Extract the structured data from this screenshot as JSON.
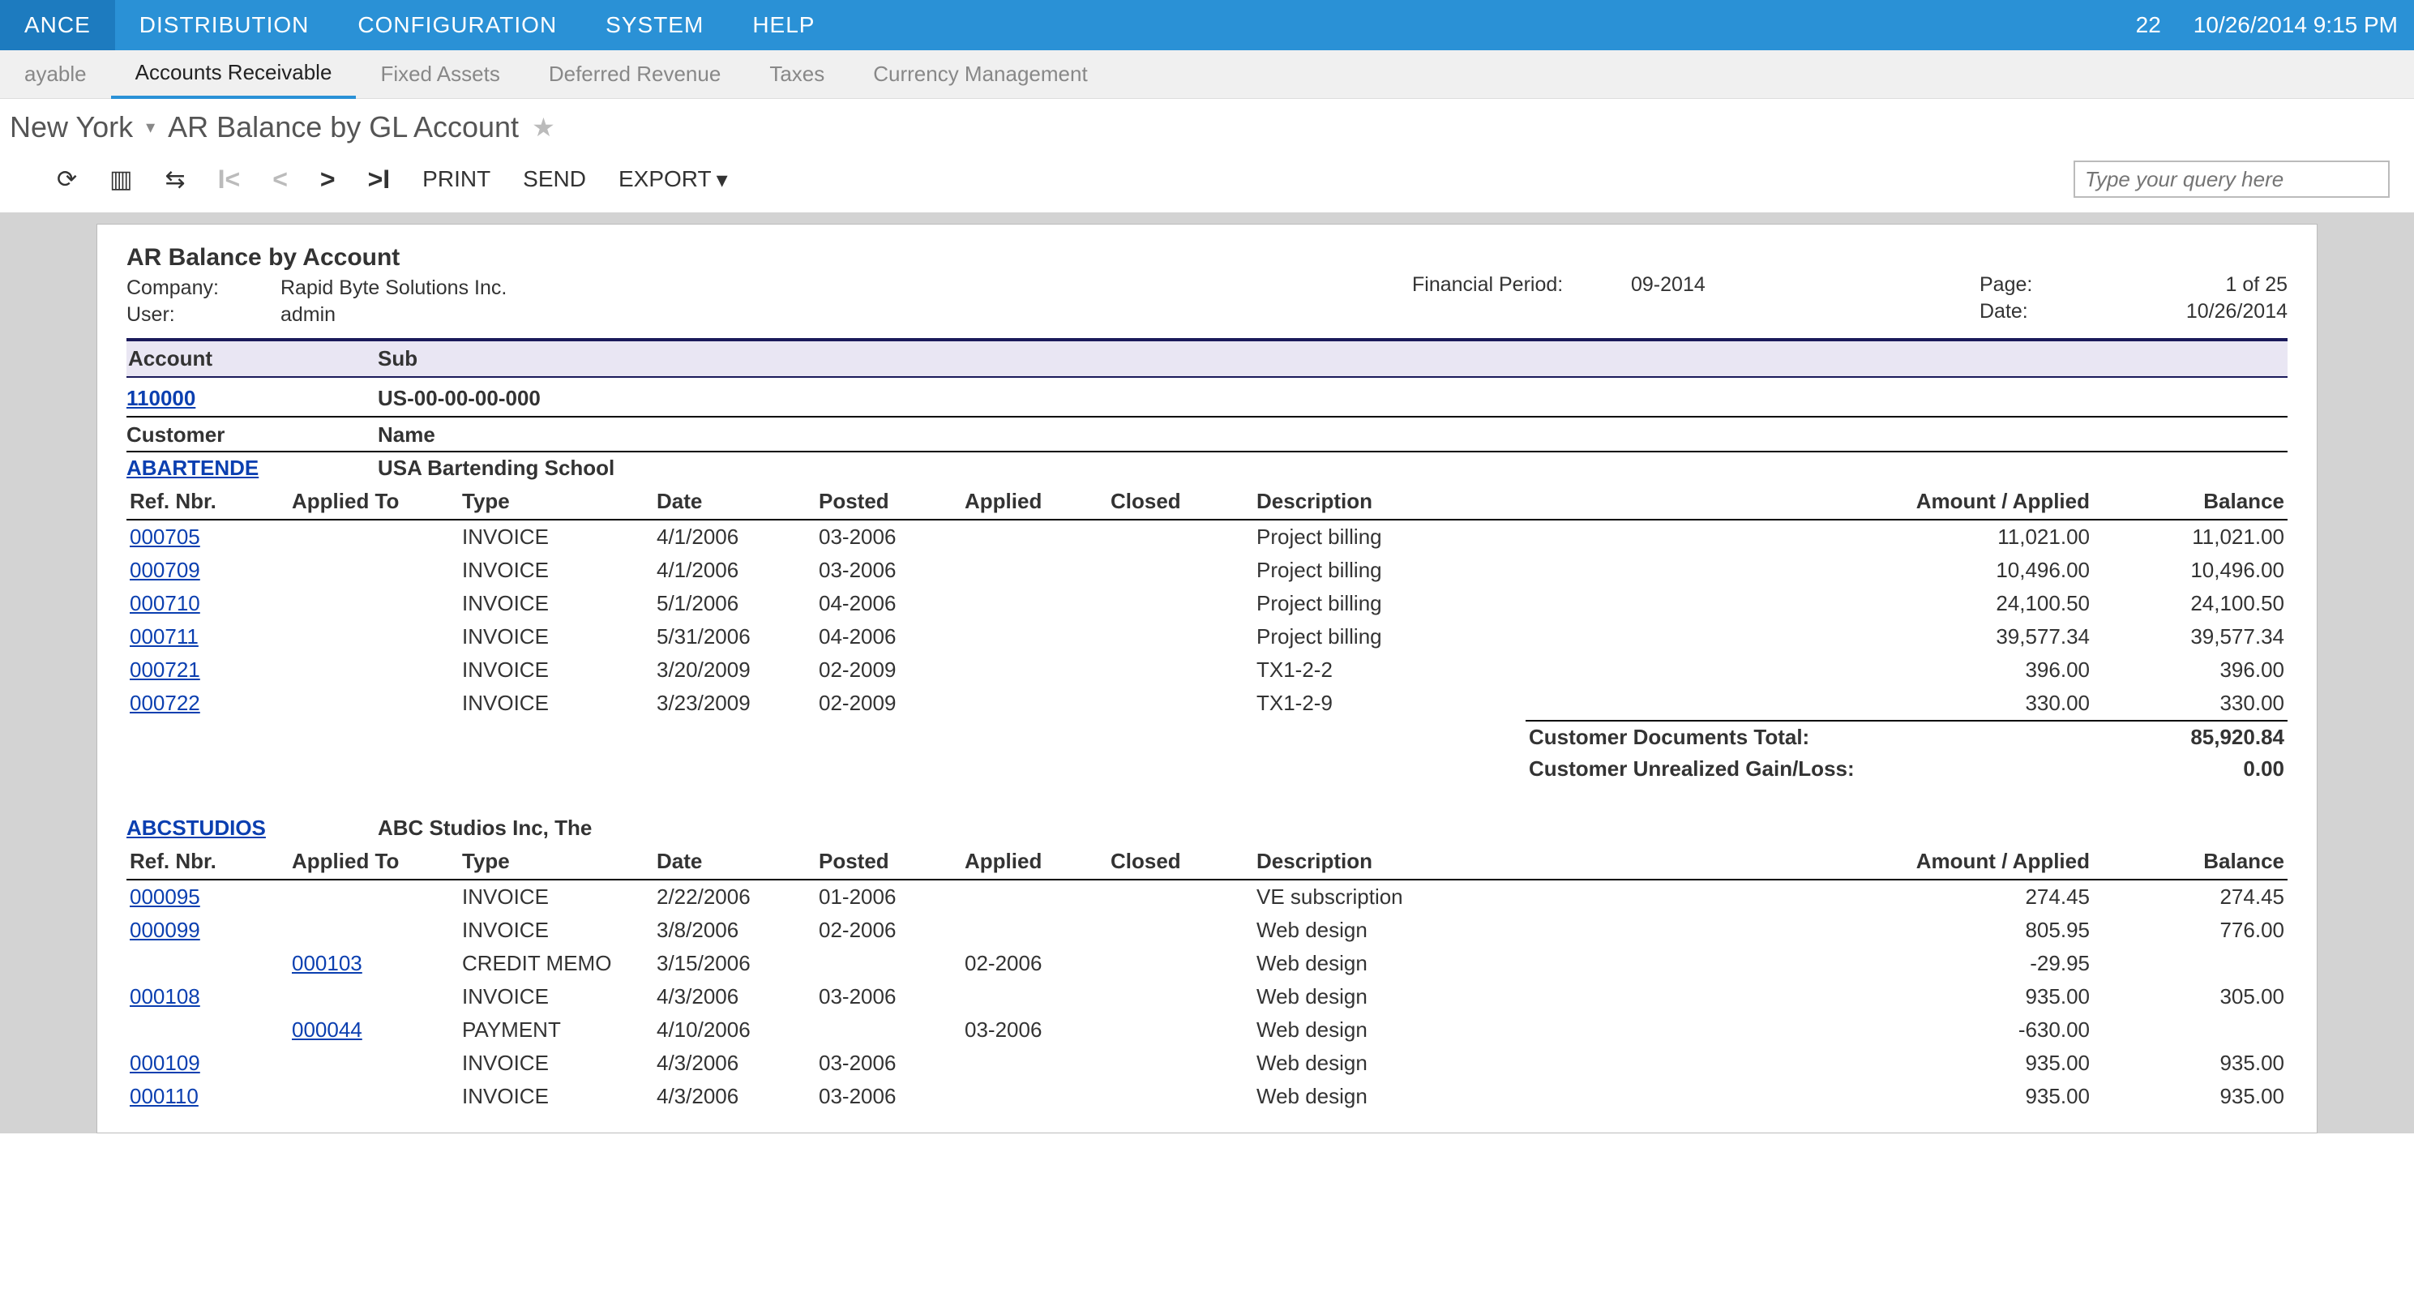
{
  "topmenu": {
    "items": [
      "ANCE",
      "DISTRIBUTION",
      "CONFIGURATION",
      "SYSTEM",
      "HELP"
    ],
    "active": 0,
    "badge": "22",
    "datetime": "10/26/2014  9:15 PM"
  },
  "submenu": {
    "items": [
      "ayable",
      "Accounts Receivable",
      "Fixed Assets",
      "Deferred Revenue",
      "Taxes",
      "Currency Management"
    ],
    "active": 1
  },
  "title": {
    "company": "New York",
    "screen": "AR Balance by GL Account"
  },
  "toolbar": {
    "print": "PRINT",
    "send": "SEND",
    "export": "EXPORT",
    "query_placeholder": "Type your query here"
  },
  "report": {
    "title": "AR Balance by Account",
    "company_label": "Company:",
    "company": "Rapid Byte Solutions Inc.",
    "user_label": "User:",
    "user": "admin",
    "finperiod_label": "Financial Period:",
    "finperiod": "09-2014",
    "page_label": "Page:",
    "page": "1 of 25",
    "date_label": "Date:",
    "date": "10/26/2014",
    "account_label": "Account",
    "sub_label": "Sub",
    "account": "110000",
    "sub": "US-00-00-00-000",
    "customer_label": "Customer",
    "name_label": "Name",
    "cols": {
      "ref": "Ref. Nbr.",
      "appto": "Applied To",
      "type": "Type",
      "date": "Date",
      "posted": "Posted",
      "applied": "Applied",
      "closed": "Closed",
      "desc": "Description",
      "amt": "Amount / Applied",
      "bal": "Balance"
    },
    "totals_labels": {
      "docs": "Customer Documents Total:",
      "url": "Customer Unrealized Gain/Loss:"
    },
    "customers": [
      {
        "code": "ABARTENDE",
        "name": "USA Bartending School",
        "rows": [
          {
            "ref": "000705",
            "appto": "",
            "type": "INVOICE",
            "date": "4/1/2006",
            "posted": "03-2006",
            "applied": "",
            "closed": "",
            "desc": "Project billing",
            "amt": "11,021.00",
            "bal": "11,021.00"
          },
          {
            "ref": "000709",
            "appto": "",
            "type": "INVOICE",
            "date": "4/1/2006",
            "posted": "03-2006",
            "applied": "",
            "closed": "",
            "desc": "Project billing",
            "amt": "10,496.00",
            "bal": "10,496.00"
          },
          {
            "ref": "000710",
            "appto": "",
            "type": "INVOICE",
            "date": "5/1/2006",
            "posted": "04-2006",
            "applied": "",
            "closed": "",
            "desc": "Project billing",
            "amt": "24,100.50",
            "bal": "24,100.50"
          },
          {
            "ref": "000711",
            "appto": "",
            "type": "INVOICE",
            "date": "5/31/2006",
            "posted": "04-2006",
            "applied": "",
            "closed": "",
            "desc": "Project billing",
            "amt": "39,577.34",
            "bal": "39,577.34"
          },
          {
            "ref": "000721",
            "appto": "",
            "type": "INVOICE",
            "date": "3/20/2009",
            "posted": "02-2009",
            "applied": "",
            "closed": "",
            "desc": "TX1-2-2",
            "amt": "396.00",
            "bal": "396.00"
          },
          {
            "ref": "000722",
            "appto": "",
            "type": "INVOICE",
            "date": "3/23/2009",
            "posted": "02-2009",
            "applied": "",
            "closed": "",
            "desc": "TX1-2-9",
            "amt": "330.00",
            "bal": "330.00"
          }
        ],
        "totals": {
          "docs": "85,920.84",
          "url": "0.00"
        }
      },
      {
        "code": "ABCSTUDIOS",
        "name": "ABC Studios Inc, The",
        "rows": [
          {
            "ref": "000095",
            "appto": "",
            "type": "INVOICE",
            "date": "2/22/2006",
            "posted": "01-2006",
            "applied": "",
            "closed": "",
            "desc": "VE subscription",
            "amt": "274.45",
            "bal": "274.45"
          },
          {
            "ref": "000099",
            "appto": "",
            "type": "INVOICE",
            "date": "3/8/2006",
            "posted": "02-2006",
            "applied": "",
            "closed": "",
            "desc": "Web design",
            "amt": "805.95",
            "bal": "776.00"
          },
          {
            "ref": "",
            "appto": "000103",
            "type": "CREDIT MEMO",
            "date": "3/15/2006",
            "posted": "",
            "applied": "02-2006",
            "closed": "",
            "desc": "Web design",
            "amt": "-29.95",
            "bal": ""
          },
          {
            "ref": "000108",
            "appto": "",
            "type": "INVOICE",
            "date": "4/3/2006",
            "posted": "03-2006",
            "applied": "",
            "closed": "",
            "desc": "Web design",
            "amt": "935.00",
            "bal": "305.00"
          },
          {
            "ref": "",
            "appto": "000044",
            "type": "PAYMENT",
            "date": "4/10/2006",
            "posted": "",
            "applied": "03-2006",
            "closed": "",
            "desc": "Web design",
            "amt": "-630.00",
            "bal": ""
          },
          {
            "ref": "000109",
            "appto": "",
            "type": "INVOICE",
            "date": "4/3/2006",
            "posted": "03-2006",
            "applied": "",
            "closed": "",
            "desc": "Web design",
            "amt": "935.00",
            "bal": "935.00"
          },
          {
            "ref": "000110",
            "appto": "",
            "type": "INVOICE",
            "date": "4/3/2006",
            "posted": "03-2006",
            "applied": "",
            "closed": "",
            "desc": "Web design",
            "amt": "935.00",
            "bal": "935.00"
          }
        ],
        "totals": null
      }
    ]
  }
}
